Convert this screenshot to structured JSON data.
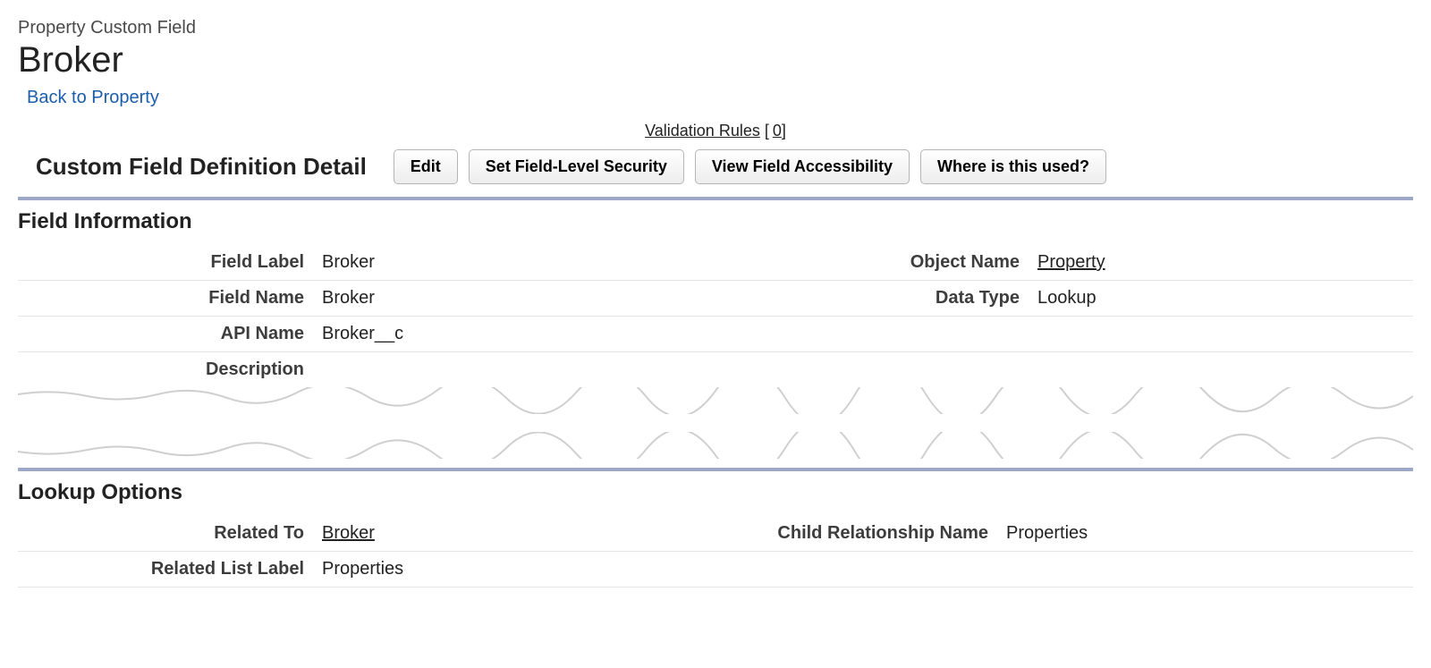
{
  "header": {
    "type_label": "Property Custom Field",
    "title": "Broker",
    "back_link": "Back to Property"
  },
  "validation": {
    "label": "Validation Rules",
    "count": "0"
  },
  "detail_section": {
    "title": "Custom Field Definition Detail",
    "buttons": {
      "edit": "Edit",
      "set_fls": "Set Field-Level Security",
      "view_access": "View Field Accessibility",
      "where_used": "Where is this used?"
    }
  },
  "field_info": {
    "heading": "Field Information",
    "rows": {
      "field_label_lbl": "Field Label",
      "field_label_val": "Broker",
      "object_name_lbl": "Object Name",
      "object_name_val": "Property",
      "field_name_lbl": "Field Name",
      "field_name_val": "Broker",
      "data_type_lbl": "Data Type",
      "data_type_val": "Lookup",
      "api_name_lbl": "API Name",
      "api_name_val": "Broker__c",
      "description_lbl": "Description"
    }
  },
  "lookup_options": {
    "heading": "Lookup Options",
    "rows": {
      "related_to_lbl": "Related To",
      "related_to_val": "Broker",
      "child_rel_lbl": "Child Relationship Name",
      "child_rel_val": "Properties",
      "related_list_lbl": "Related List Label",
      "related_list_val": "Properties"
    }
  }
}
